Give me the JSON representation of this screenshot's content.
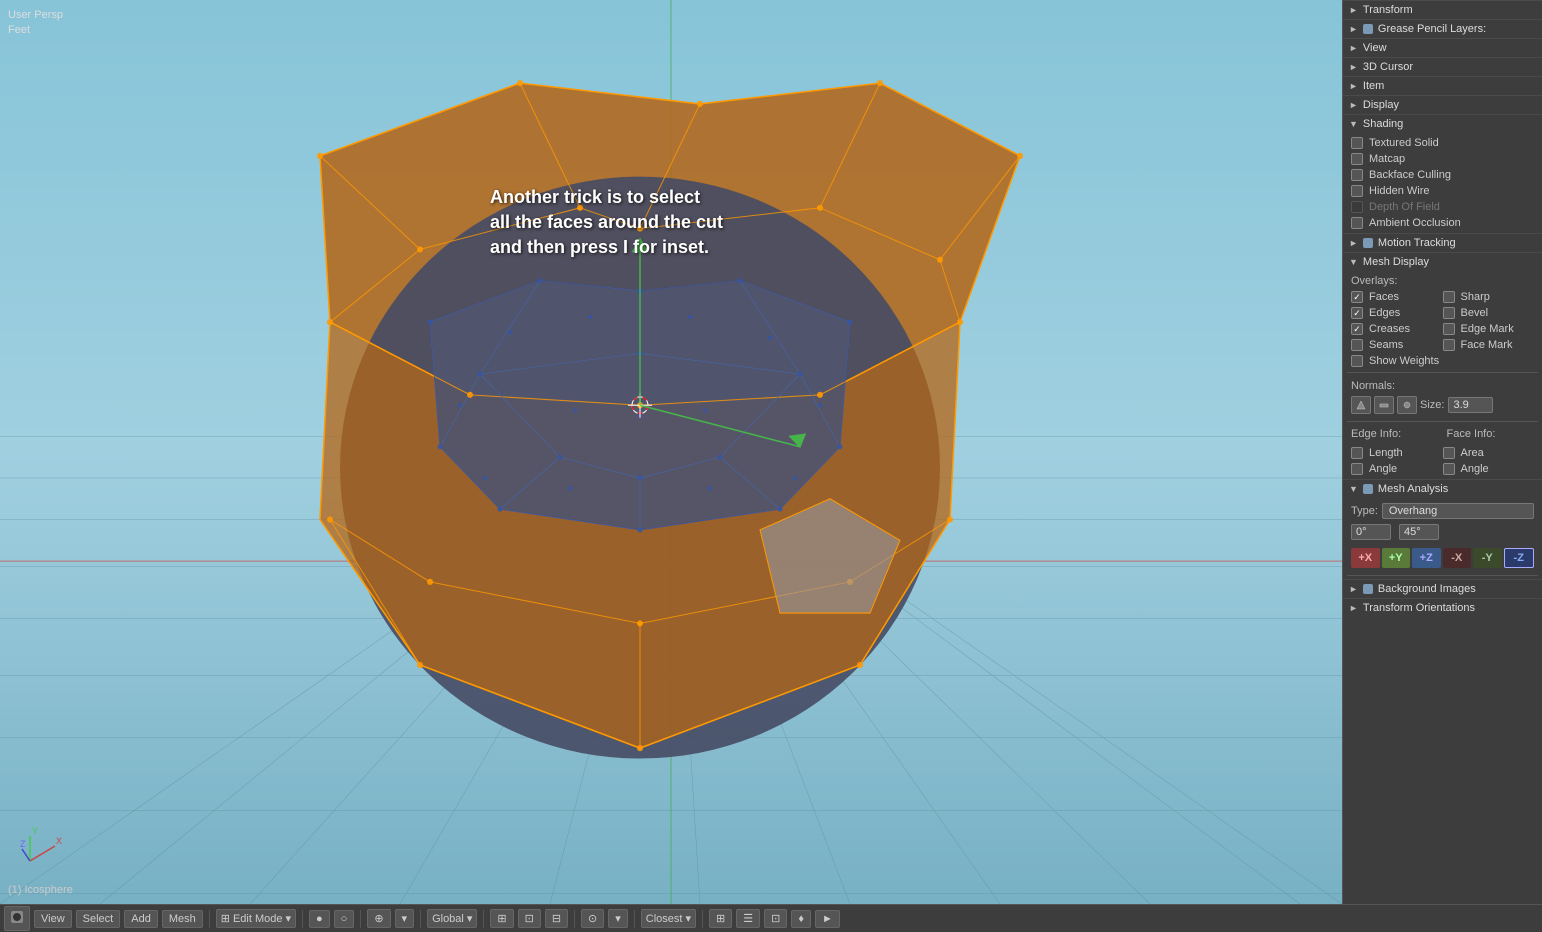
{
  "viewport": {
    "label_line1": "User Persp",
    "label_line2": "Feet",
    "annotation": "Another trick is to select\nall the faces around the cut\nand then press I for inset.",
    "object_label": "(1) Icosphere"
  },
  "right_panel": {
    "sections": [
      {
        "id": "transform",
        "label": "Transform",
        "collapsed": true,
        "arrow": "►"
      },
      {
        "id": "grease-pencil",
        "label": "Grease Pencil Layers:",
        "collapsed": true,
        "arrow": "►",
        "dot_color": "#7a9ab5"
      },
      {
        "id": "view",
        "label": "View",
        "collapsed": true,
        "arrow": "►"
      },
      {
        "id": "3d-cursor",
        "label": "3D Cursor",
        "collapsed": true,
        "arrow": "►"
      },
      {
        "id": "item",
        "label": "Item",
        "collapsed": true,
        "arrow": "►"
      },
      {
        "id": "display",
        "label": "Display",
        "collapsed": true,
        "arrow": "►"
      },
      {
        "id": "shading",
        "label": "Shading",
        "collapsed": false,
        "arrow": "▼"
      }
    ],
    "shading": {
      "checkboxes": [
        {
          "id": "textured-solid",
          "label": "Textured Solid",
          "checked": false
        },
        {
          "id": "matcap",
          "label": "Matcap",
          "checked": false
        },
        {
          "id": "backface-culling",
          "label": "Backface Culling",
          "checked": false
        },
        {
          "id": "hidden-wire",
          "label": "Hidden Wire",
          "checked": false
        },
        {
          "id": "depth-of-field",
          "label": "Depth Of Field",
          "checked": false,
          "disabled": true
        },
        {
          "id": "ambient-occlusion",
          "label": "Ambient Occlusion",
          "checked": false
        }
      ]
    },
    "motion_tracking": {
      "label": "Motion Tracking",
      "collapsed": true,
      "arrow": "►",
      "dot_color": "#7a9ab5"
    },
    "mesh_display": {
      "label": "Mesh Display",
      "collapsed": false,
      "arrow": "▼",
      "overlays_label": "Overlays:",
      "overlays": [
        {
          "col1_label": "Faces",
          "col1_checked": true,
          "col2_label": "Sharp",
          "col2_checked": false
        },
        {
          "col1_label": "Edges",
          "col1_checked": true,
          "col2_label": "Bevel",
          "col2_checked": false
        },
        {
          "col1_label": "Creases",
          "col1_checked": true,
          "col2_label": "Edge Mark",
          "col2_checked": false
        },
        {
          "col1_label": "Seams",
          "col1_checked": false,
          "col2_label": "Face Mark",
          "col2_checked": false
        }
      ],
      "show_weights_label": "Show Weights",
      "normals_label": "Normals:",
      "normal_buttons": [
        "face",
        "loop",
        "vertex"
      ],
      "size_label": "Size:",
      "size_value": "3.9",
      "edge_info_label": "Edge Info:",
      "face_info_label": "Face Info:",
      "edge_checkboxes": [
        {
          "label": "Length",
          "checked": false
        },
        {
          "label": "Angle",
          "checked": false
        }
      ],
      "face_checkboxes": [
        {
          "label": "Area",
          "checked": false
        },
        {
          "label": "Angle",
          "checked": false
        }
      ]
    },
    "mesh_analysis": {
      "label": "Mesh Analysis",
      "collapsed": false,
      "arrow": "▼",
      "dot_color": "#7a9ab5",
      "type_label": "Type:",
      "type_value": "Overhang",
      "range_min": "0°",
      "range_max": "45°"
    },
    "axis_buttons": [
      {
        "label": "+X",
        "class": "pos-x"
      },
      {
        "label": "+Y",
        "class": "pos-y"
      },
      {
        "label": "+Z",
        "class": "pos-z"
      },
      {
        "label": "-X",
        "class": "neg-x"
      },
      {
        "label": "-Y",
        "class": "neg-y"
      },
      {
        "label": "-Z",
        "class": "neg-z"
      }
    ],
    "bottom_sections": [
      {
        "label": "Background Images",
        "collapsed": true,
        "arrow": "►",
        "dot_color": "#7a9ab5"
      },
      {
        "label": "Transform Orientations",
        "collapsed": true,
        "arrow": "►"
      }
    ]
  },
  "bottom_toolbar": {
    "left_icon": "■",
    "menu_items": [
      "View",
      "Select",
      "Add",
      "Mesh"
    ],
    "mode_dropdown": "Edit Mode",
    "shading_buttons": [
      "●",
      "○"
    ],
    "transform_dropdown": "Global",
    "snap_buttons": [
      "⊕",
      "▾"
    ],
    "pivot_dropdown": "Closest",
    "extra_buttons": [
      "⊞",
      "☰",
      "⊡",
      "♦",
      "►"
    ]
  }
}
